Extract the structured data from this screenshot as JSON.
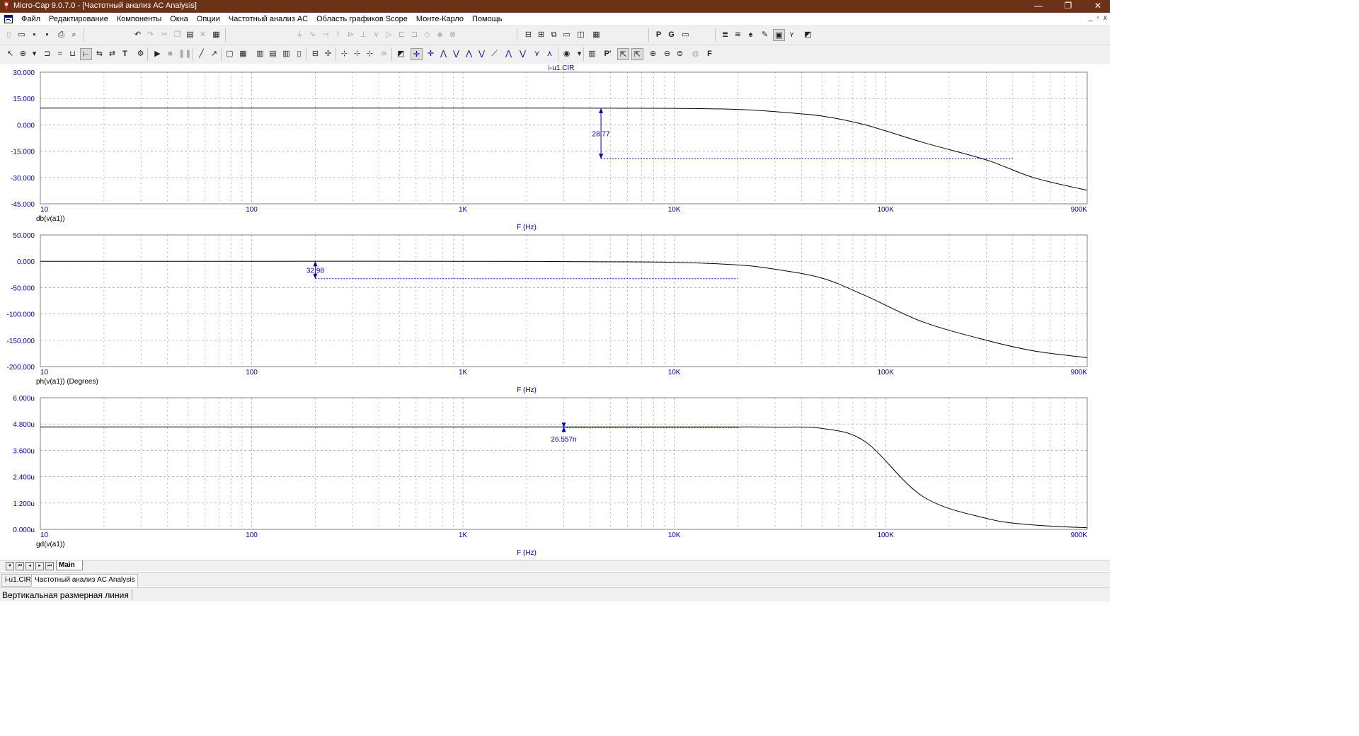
{
  "window": {
    "title": "Micro-Cap 9.0.7.0 - [Частотный анализ AC Analysis]",
    "controls": [
      "—",
      "❐",
      "✕"
    ]
  },
  "menu": {
    "items": [
      "Файл",
      "Редактирование",
      "Компоненты",
      "Окна",
      "Опции",
      "Частотный анализ AC",
      "Область графиков Scope",
      "Монте-Карло",
      "Помощь"
    ],
    "mdi_controls": [
      "_",
      "▫",
      "x"
    ]
  },
  "colors": {
    "accent": "#0000b0",
    "titlebar": "#6b3217",
    "grid": "#a0a0a0",
    "curve": "#000000"
  },
  "plot": {
    "file_label": "i-u1.CIR",
    "charts": [
      {
        "ylabel": "db(v(a1))",
        "xlabel": "F (Hz)",
        "yticks": [
          "30.000",
          "15.000",
          "0.000",
          "-15.000",
          "-30.000",
          "-45.000"
        ],
        "ymax": 30,
        "ymin": -45,
        "xticks": [
          "10",
          "100",
          "1K",
          "10K",
          "100K",
          "900K"
        ],
        "dim_text": "28.77",
        "curve_y": [
          9.5,
          9.5,
          9.5,
          9.5,
          9.4,
          8.8,
          7.5,
          5.0,
          0.0,
          -10.0,
          -20.0,
          -30.0,
          -37.3
        ],
        "dim_from_x": 4500,
        "dim_top_y": 9.5,
        "dim_bottom_y": -19.3,
        "dim_end_x": 400000
      },
      {
        "ylabel": "ph(v(a1)) (Degrees)",
        "xlabel": "F (Hz)",
        "yticks": [
          "50.000",
          "0.000",
          "-50.000",
          "-100.000",
          "-150.000",
          "-200.000"
        ],
        "ymax": 50,
        "ymin": -200,
        "xticks": [
          "10",
          "100",
          "1K",
          "10K",
          "100K",
          "900K"
        ],
        "dim_text": "32.98",
        "curve_y": [
          0,
          0,
          0,
          -0.5,
          -2,
          -7,
          -15,
          -32,
          -65,
          -115,
          -150,
          -170,
          -183
        ],
        "dim_from_x": 200,
        "dim_top_y": 0,
        "dim_bottom_y": -32.98,
        "dim_end_x": 20000
      },
      {
        "ylabel": "gd(v(a1))",
        "xlabel": "F (Hz)",
        "yticks": [
          "6.000u",
          "4.800u",
          "3.600u",
          "2.400u",
          "1.200u",
          "0.000u"
        ],
        "ymax": 6,
        "ymin": 0,
        "xticks": [
          "10",
          "100",
          "1K",
          "10K",
          "100K",
          "900K"
        ],
        "dim_text": "26.557n",
        "curve_y": [
          4.67,
          4.67,
          4.67,
          4.67,
          4.67,
          4.67,
          4.66,
          4.6,
          4.0,
          1.5,
          0.5,
          0.2,
          0.07
        ],
        "dim_from_x": 3000,
        "dim_top_y": 4.67,
        "dim_bottom_y": 4.64,
        "dim_end_x": 20000
      }
    ],
    "curve_x": [
      10,
      100,
      1000,
      3000,
      10000,
      20000,
      30000,
      50000,
      80000,
      150000,
      300000,
      500000,
      900000
    ]
  },
  "sheet_tabs": {
    "active": "Main"
  },
  "doc_tabs": [
    "i-u1.CIR",
    "Частотный анализ AC Analysis"
  ],
  "status": {
    "text": "Вертикальная размерная линия"
  }
}
